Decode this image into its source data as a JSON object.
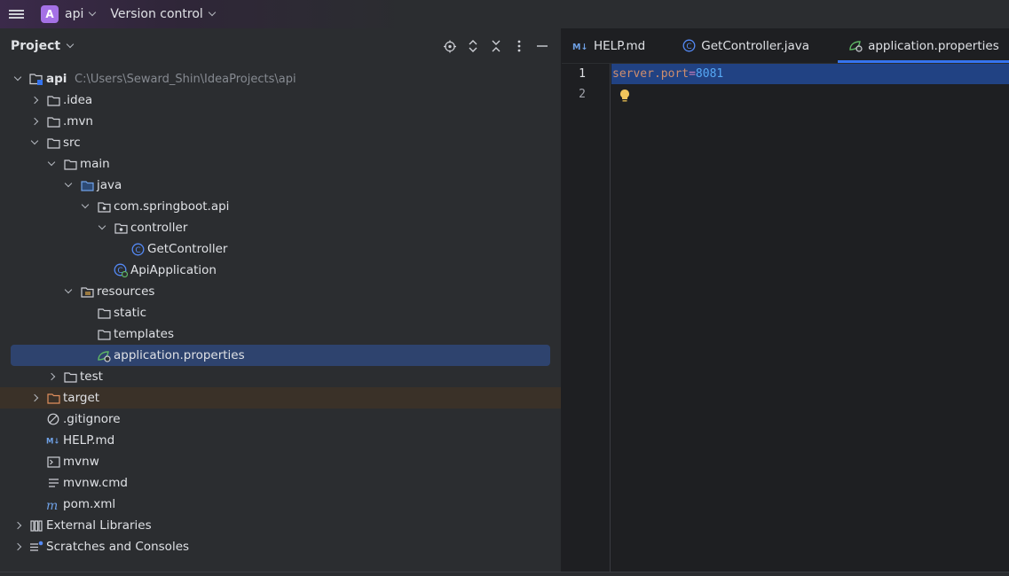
{
  "titlebar": {
    "project_badge": "A",
    "project_name": "api",
    "vcs_label": "Version control"
  },
  "project_panel": {
    "title": "Project"
  },
  "tree": [
    {
      "label": "api",
      "hint": "C:\\Users\\Seward_Shin\\IdeaProjects\\api",
      "depth": 0,
      "arrow": "down",
      "icon": "module-folder-icon"
    },
    {
      "label": ".idea",
      "depth": 1,
      "arrow": "right",
      "icon": "folder-icon"
    },
    {
      "label": ".mvn",
      "depth": 1,
      "arrow": "right",
      "icon": "folder-icon"
    },
    {
      "label": "src",
      "depth": 1,
      "arrow": "down",
      "icon": "folder-icon"
    },
    {
      "label": "main",
      "depth": 2,
      "arrow": "down",
      "icon": "folder-icon"
    },
    {
      "label": "java",
      "depth": 3,
      "arrow": "down",
      "icon": "source-folder-icon"
    },
    {
      "label": "com.springboot.api",
      "depth": 4,
      "arrow": "down",
      "icon": "package-icon"
    },
    {
      "label": "controller",
      "depth": 5,
      "arrow": "down",
      "icon": "package-icon"
    },
    {
      "label": "GetController",
      "depth": 6,
      "arrow": "none",
      "icon": "java-class-icon"
    },
    {
      "label": "ApiApplication",
      "depth": 5,
      "arrow": "none",
      "icon": "spring-boot-class-icon"
    },
    {
      "label": "resources",
      "depth": 3,
      "arrow": "down",
      "icon": "resources-folder-icon"
    },
    {
      "label": "static",
      "depth": 4,
      "arrow": "none",
      "icon": "folder-icon"
    },
    {
      "label": "templates",
      "depth": 4,
      "arrow": "none",
      "icon": "folder-icon"
    },
    {
      "label": "application.properties",
      "depth": 4,
      "arrow": "none",
      "icon": "spring-properties-icon",
      "selected": true
    },
    {
      "label": "test",
      "depth": 2,
      "arrow": "right",
      "icon": "folder-icon"
    },
    {
      "label": "target",
      "depth": 1,
      "arrow": "right",
      "icon": "excluded-folder-icon",
      "excluded": true
    },
    {
      "label": ".gitignore",
      "depth": 1,
      "arrow": "none",
      "icon": "gitignore-icon"
    },
    {
      "label": "HELP.md",
      "depth": 1,
      "arrow": "none",
      "icon": "markdown-icon"
    },
    {
      "label": "mvnw",
      "depth": 1,
      "arrow": "none",
      "icon": "shell-script-icon"
    },
    {
      "label": "mvnw.cmd",
      "depth": 1,
      "arrow": "none",
      "icon": "text-file-icon"
    },
    {
      "label": "pom.xml",
      "depth": 1,
      "arrow": "none",
      "icon": "maven-icon"
    },
    {
      "label": "External Libraries",
      "depth": 0,
      "arrow": "right",
      "icon": "libraries-icon"
    },
    {
      "label": "Scratches and Consoles",
      "depth": 0,
      "arrow": "right",
      "icon": "scratches-icon"
    }
  ],
  "editor": {
    "tabs": [
      {
        "label": "HELP.md",
        "icon": "markdown-icon",
        "active": false
      },
      {
        "label": "GetController.java",
        "icon": "java-class-icon",
        "active": false
      },
      {
        "label": "application.properties",
        "icon": "spring-properties-icon",
        "active": true
      }
    ],
    "line_numbers": [
      "1",
      "2"
    ],
    "code": {
      "key": "server.port",
      "eq": "=",
      "value": "8081"
    }
  },
  "colors": {
    "accent": "#3574f0",
    "selection": "#2e436e",
    "project_badge": "#a571e6"
  }
}
